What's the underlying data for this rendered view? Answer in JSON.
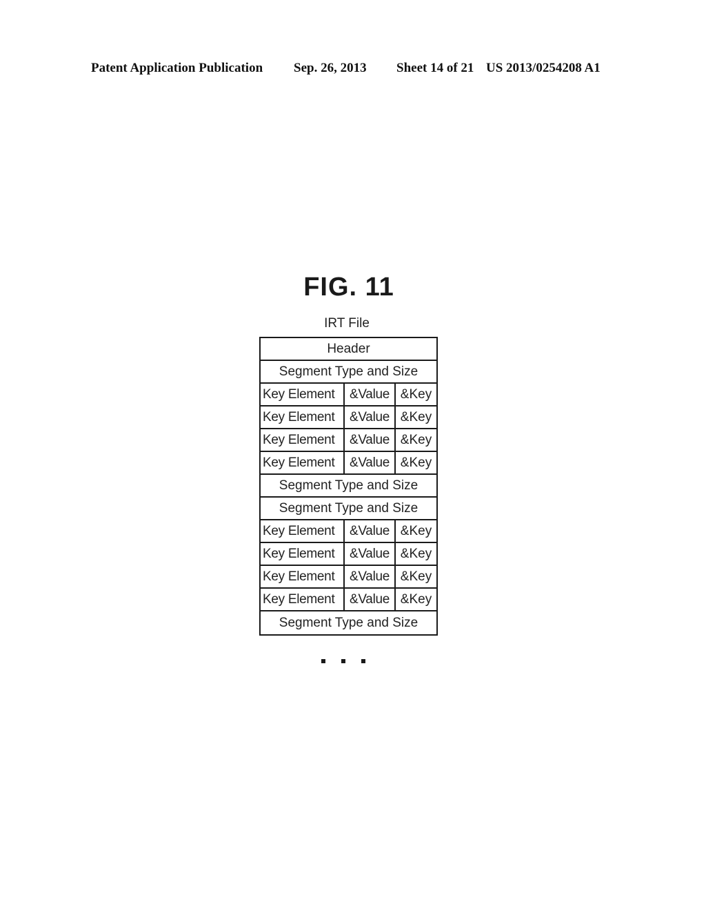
{
  "header": {
    "publication": "Patent Application Publication",
    "date": "Sep. 26, 2013",
    "sheet": "Sheet 14 of 21",
    "number": "US 2013/0254208 A1"
  },
  "figure": {
    "title": "FIG. 11",
    "file_label": "IRT File"
  },
  "table": {
    "rows": [
      {
        "type": "full",
        "text": "Header"
      },
      {
        "type": "full",
        "text": "Segment Type and Size"
      },
      {
        "type": "split",
        "cells": [
          "Key Element",
          "&Value",
          "&Key"
        ]
      },
      {
        "type": "split",
        "cells": [
          "Key Element",
          "&Value",
          "&Key"
        ]
      },
      {
        "type": "split",
        "cells": [
          "Key Element",
          "&Value",
          "&Key"
        ]
      },
      {
        "type": "split",
        "cells": [
          "Key Element",
          "&Value",
          "&Key"
        ]
      },
      {
        "type": "full",
        "text": "Segment Type and Size"
      },
      {
        "type": "full",
        "text": "Segment Type and Size"
      },
      {
        "type": "split",
        "cells": [
          "Key Element",
          "&Value",
          "&Key"
        ]
      },
      {
        "type": "split",
        "cells": [
          "Key Element",
          "&Value",
          "&Key"
        ]
      },
      {
        "type": "split",
        "cells": [
          "Key Element",
          "&Value",
          "&Key"
        ]
      },
      {
        "type": "split",
        "cells": [
          "Key Element",
          "&Value",
          "&Key"
        ]
      },
      {
        "type": "full",
        "text": "Segment Type and Size"
      }
    ]
  },
  "continuation": {
    "symbol": "ellipsis",
    "count": 3
  }
}
